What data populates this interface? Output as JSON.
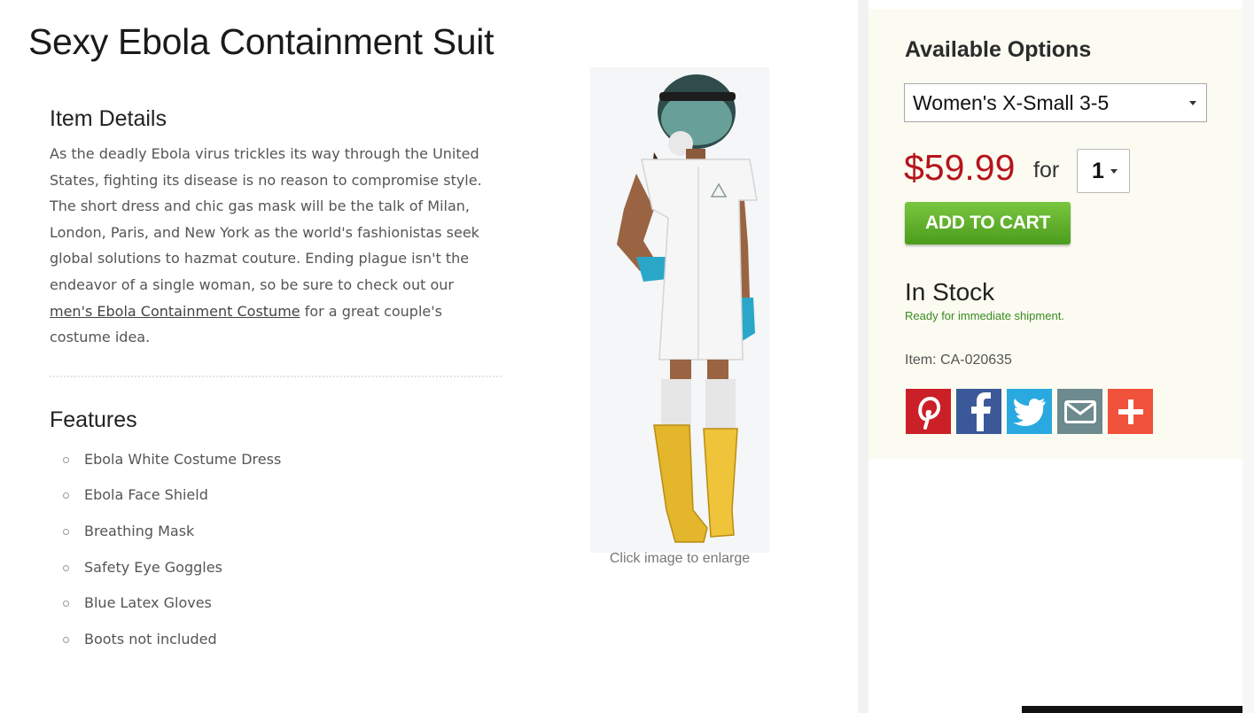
{
  "product": {
    "title": "Sexy Ebola Containment Suit"
  },
  "details": {
    "heading": "Item Details",
    "description_before_link": "As the deadly Ebola virus trickles its way through the United States, fighting its disease is no reason to compromise style. The short dress and chic gas mask will be the talk of Milan, London, Paris, and New York as the world's fashionistas seek global solutions to hazmat couture. Ending plague isn't the endeavor of a single woman, so be sure to check out our ",
    "link_text": "men's Ebola Containment Costume",
    "description_after_link": " for a great couple's costume idea."
  },
  "features": {
    "heading": "Features",
    "items": [
      "Ebola White Costume Dress",
      "Ebola Face Shield",
      "Breathing Mask",
      "Safety Eye Goggles",
      "Blue Latex Gloves",
      "Boots not included"
    ]
  },
  "image": {
    "caption": "Click image to enlarge"
  },
  "purchase": {
    "options_heading": "Available Options",
    "size_selected": "Women's X-Small 3-5",
    "price": "$59.99",
    "for_label": "for",
    "quantity": "1",
    "add_to_cart_label": "ADD TO CART",
    "stock_status": "In Stock",
    "stock_note": "Ready for immediate shipment.",
    "item_number": "Item: CA-020635",
    "price_color": "#b5141b",
    "cart_button_color": "#5fae2b"
  },
  "share": [
    {
      "icon": "pinterest-icon",
      "color": "#cb2027"
    },
    {
      "icon": "facebook-icon",
      "color": "#3b5998"
    },
    {
      "icon": "twitter-icon",
      "color": "#2aa9e0"
    },
    {
      "icon": "email-icon",
      "color": "#6d8a8e"
    },
    {
      "icon": "plus-icon",
      "color": "#f0523c"
    }
  ]
}
